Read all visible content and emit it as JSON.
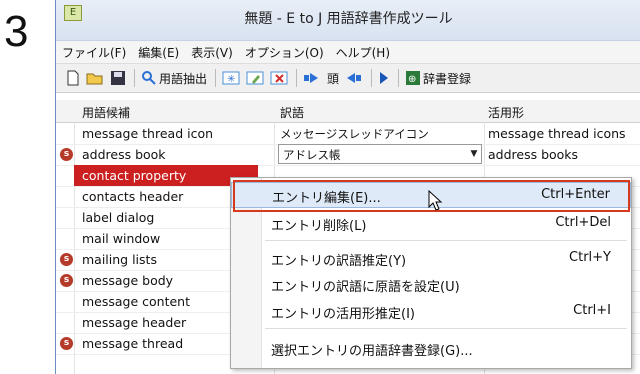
{
  "step_number": "3",
  "window": {
    "title": "無題 - E to J 用語辞書作成ツール"
  },
  "menu": [
    "ファイル(F)",
    "編集(E)",
    "表示(V)",
    "オプション(O)",
    "ヘルプ(H)"
  ],
  "toolbar": {
    "extract_label": "用語抽出",
    "register_label": "辞書登録"
  },
  "columns": [
    "用語候補",
    "訳語",
    "活用形"
  ],
  "rows": [
    {
      "term": "message thread icon",
      "translation": "メッセージスレッドアイコン",
      "inflection": "message thread icons",
      "marked": false
    },
    {
      "term": "address book",
      "translation": "アドレス帳",
      "inflection": "address books",
      "marked": true
    },
    {
      "term": "contact property",
      "translation": "",
      "inflection": "",
      "marked": false
    },
    {
      "term": "contacts header",
      "translation": "",
      "inflection": "",
      "marked": false
    },
    {
      "term": "label dialog",
      "translation": "",
      "inflection": "",
      "marked": false
    },
    {
      "term": "mail window",
      "translation": "",
      "inflection": "",
      "marked": false
    },
    {
      "term": "mailing lists",
      "translation": "",
      "inflection": "",
      "marked": true
    },
    {
      "term": "message body",
      "translation": "",
      "inflection": "",
      "marked": true
    },
    {
      "term": "message content",
      "translation": "",
      "inflection": "",
      "marked": false
    },
    {
      "term": "message header",
      "translation": "",
      "inflection": "",
      "marked": false
    },
    {
      "term": "message thread",
      "translation": "",
      "inflection": "",
      "marked": true
    }
  ],
  "context_menu": [
    {
      "label": "エントリ編集(E)...",
      "shortcut": "Ctrl+Enter"
    },
    {
      "label": "エントリ削除(L)",
      "shortcut": "Ctrl+Del"
    },
    {
      "label": "エントリの訳語推定(Y)",
      "shortcut": "Ctrl+Y"
    },
    {
      "label": "エントリの訳語に原語を設定(U)",
      "shortcut": ""
    },
    {
      "label": "エントリの活用形推定(I)",
      "shortcut": "Ctrl+I"
    },
    {
      "label": "選択エントリの用語辞書登録(G)...",
      "shortcut": ""
    }
  ],
  "colors": {
    "selection": "#cc1f1f",
    "highlight_box": "#d63a1e",
    "badge": "#b63a2a"
  }
}
